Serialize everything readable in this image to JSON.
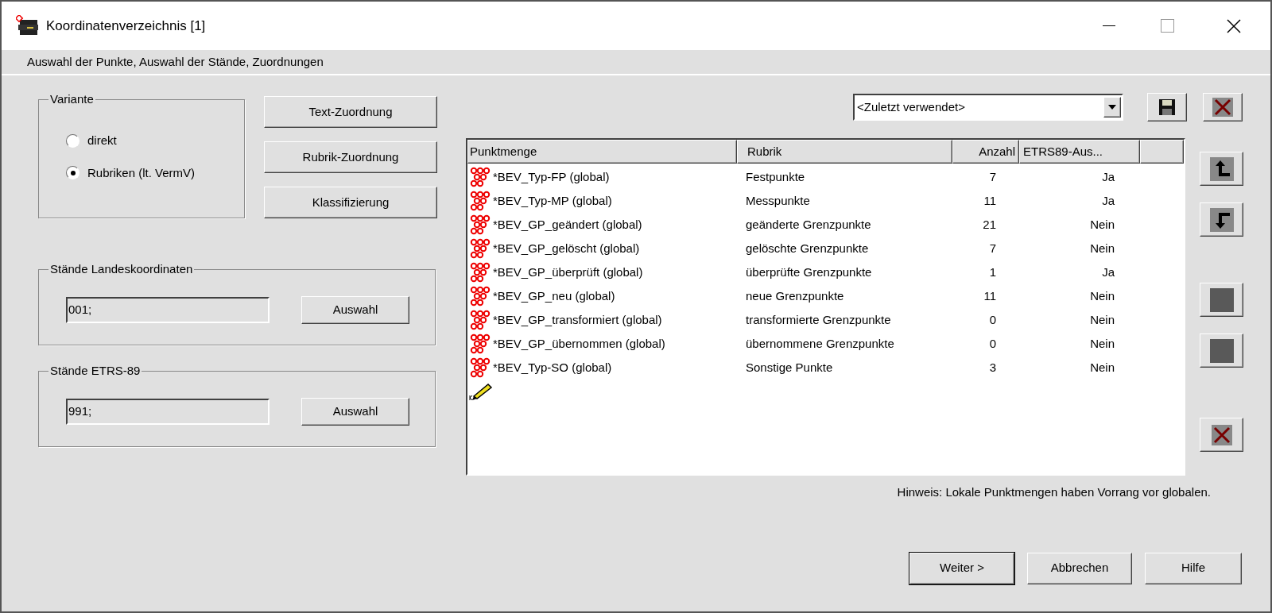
{
  "window": {
    "title": "Koordinatenverzeichnis [1]"
  },
  "subtitle": "Auswahl der Punkte, Auswahl der Stände, Zuordnungen",
  "variant": {
    "label": "Variante",
    "options": [
      {
        "label": "direkt",
        "selected": false
      },
      {
        "label": "Rubriken (lt. VermV)",
        "selected": true
      }
    ]
  },
  "assign_buttons": [
    "Text-Zuordnung",
    "Rubrik-Zuordnung",
    "Klassifizierung"
  ],
  "groups": [
    {
      "label": "Stände Landeskoordinaten",
      "value": "001;",
      "button": "Auswahl"
    },
    {
      "label": "Stände ETRS-89",
      "value": "991;",
      "button": "Auswahl"
    }
  ],
  "preset": {
    "value": "<Zuletzt verwendet>"
  },
  "table": {
    "columns": [
      "Punktmenge",
      "Rubrik",
      "Anzahl",
      "ETRS89-Aus..."
    ],
    "rows": [
      {
        "punktmenge": "*BEV_Typ-FP (global)",
        "rubrik": "Festpunkte",
        "anzahl": "7",
        "etrs": "Ja"
      },
      {
        "punktmenge": "*BEV_Typ-MP (global)",
        "rubrik": "Messpunkte",
        "anzahl": "11",
        "etrs": "Ja"
      },
      {
        "punktmenge": "*BEV_GP_geändert (global)",
        "rubrik": "geänderte Grenzpunkte",
        "anzahl": "21",
        "etrs": "Nein"
      },
      {
        "punktmenge": "*BEV_GP_gelöscht (global)",
        "rubrik": "gelöschte Grenzpunkte",
        "anzahl": "7",
        "etrs": "Nein"
      },
      {
        "punktmenge": "*BEV_GP_überprüft (global)",
        "rubrik": "überprüfte Grenzpunkte",
        "anzahl": "1",
        "etrs": "Ja"
      },
      {
        "punktmenge": "*BEV_GP_neu (global)",
        "rubrik": "neue Grenzpunkte",
        "anzahl": "11",
        "etrs": "Nein"
      },
      {
        "punktmenge": "*BEV_GP_transformiert (global)",
        "rubrik": "transformierte Grenzpunkte",
        "anzahl": "0",
        "etrs": "Nein"
      },
      {
        "punktmenge": "*BEV_GP_übernommen (global)",
        "rubrik": "übernommene Grenzpunkte",
        "anzahl": "0",
        "etrs": "Nein"
      },
      {
        "punktmenge": "*BEV_Typ-SO (global)",
        "rubrik": "Sonstige Punkte",
        "anzahl": "3",
        "etrs": "Nein"
      }
    ]
  },
  "hint": "Hinweis: Lokale Punktmengen haben Vorrang vor globalen.",
  "footer_buttons": [
    "Weiter >",
    "Abbrechen",
    "Hilfe"
  ]
}
